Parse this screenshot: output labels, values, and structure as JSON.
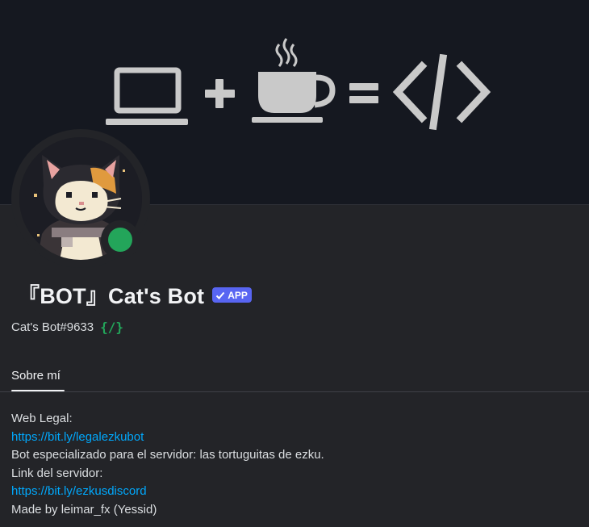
{
  "banner": {
    "icons": [
      "laptop-icon",
      "plus-icon",
      "coffee-cup-icon",
      "equals-icon",
      "code-tag-icon"
    ],
    "background_color": "#151820",
    "icon_color": "#c9c9c9"
  },
  "profile": {
    "display_name": "『BOT』Cat's Bot",
    "badge_label": "APP",
    "username": "Cat's Bot#9633",
    "command_glyph": "{/}",
    "status": "online",
    "status_color": "#23a55a",
    "badge_color": "#5865f2"
  },
  "tabs": [
    {
      "label": "Sobre mí",
      "active": true
    }
  ],
  "bio": {
    "lines": [
      {
        "text": "Web Legal:",
        "type": "text"
      },
      {
        "text": "https://bit.ly/legalezkubot",
        "type": "link"
      },
      {
        "text": "Bot especializado para el servidor: las tortuguitas de ezku.",
        "type": "text"
      },
      {
        "text": "Link del servidor:",
        "type": "text"
      },
      {
        "text": "https://bit.ly/ezkusdiscord",
        "type": "link"
      },
      {
        "text": "Made by leimar_fx (Yessid)",
        "type": "text"
      }
    ],
    "link_color": "#00a8fc"
  }
}
